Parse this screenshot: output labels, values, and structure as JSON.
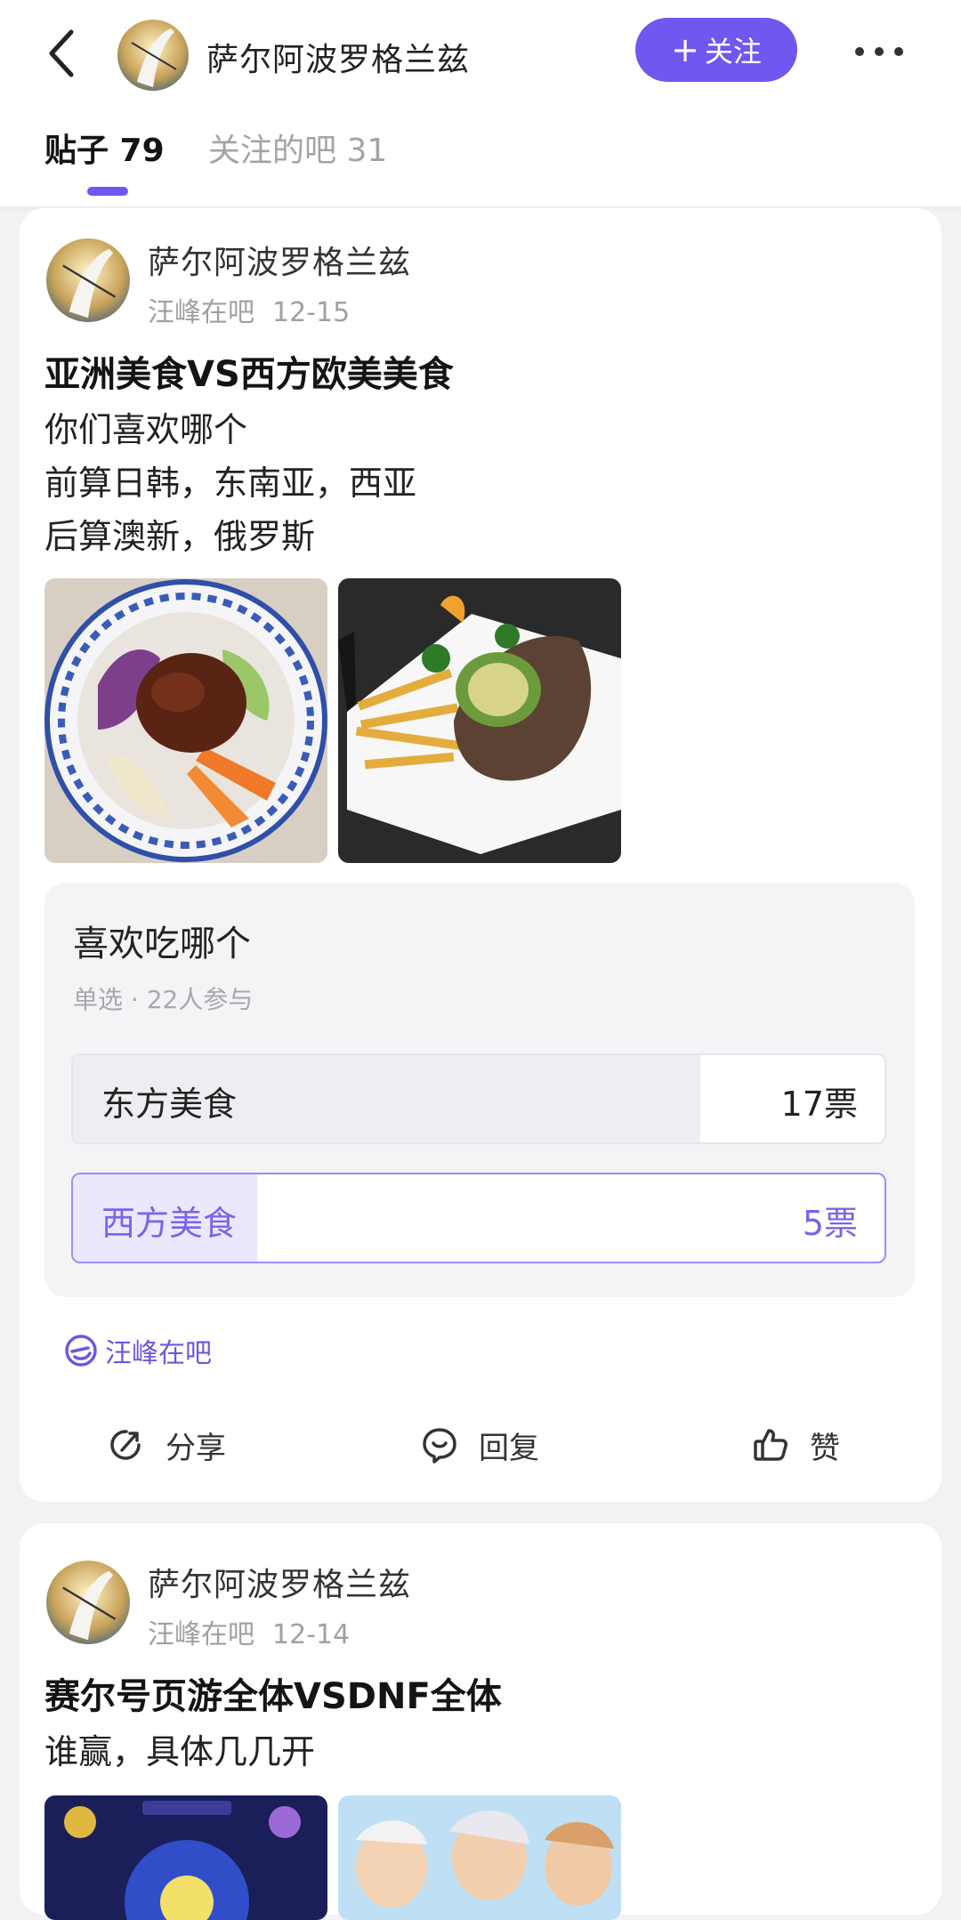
{
  "header": {
    "user_name": "萨尔阿波罗格兰兹",
    "follow_label": "关注",
    "tabs": [
      {
        "label": "贴子 79"
      },
      {
        "label": "关注的吧 31"
      }
    ]
  },
  "posts": [
    {
      "author": "萨尔阿波罗格兰兹",
      "forum": "汪峰在吧",
      "date": "12-15",
      "title": "亚洲美食VS西方欧美美食",
      "lines": [
        "你们喜欢哪个",
        "前算日韩，东南亚，西亚",
        "后算澳新，俄罗斯"
      ],
      "poll": {
        "question": "喜欢吃哪个",
        "subtitle": "单选 · 22人参与",
        "options": [
          {
            "label": "东方美食",
            "votes": "17票",
            "fraction": 0.773
          },
          {
            "label": "西方美食",
            "votes": "5票",
            "fraction": 0.227
          }
        ]
      },
      "forum_tag": "汪峰在吧",
      "actions": {
        "share": "分享",
        "reply": "回复",
        "like": "赞"
      }
    },
    {
      "author": "萨尔阿波罗格兰兹",
      "forum": "汪峰在吧",
      "date": "12-14",
      "title": "赛尔号页游全体VSDNF全体",
      "lines": [
        "谁赢，具体几几开"
      ]
    }
  ],
  "colors": {
    "accent": "#7057f0",
    "accent_light": "#ebe7fd"
  }
}
